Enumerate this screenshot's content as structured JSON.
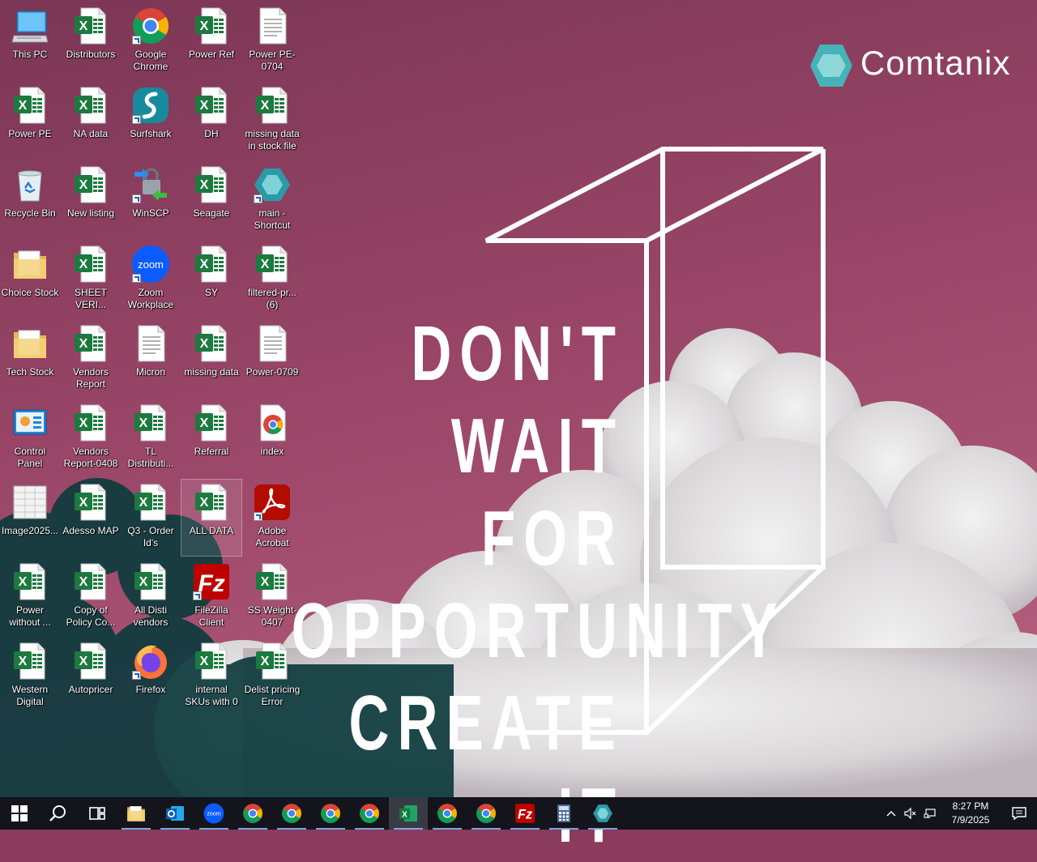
{
  "wallpaper": {
    "brand": "Comtanix",
    "quote_lines": [
      "DON'T",
      "WAIT FOR",
      "OPPORTUNITY",
      "CREATE IT"
    ],
    "colors": {
      "sky": "#8a3b5e",
      "accent": "#45b3b8"
    }
  },
  "desktop_icons": [
    {
      "label": "This PC",
      "icon": "this-pc-icon"
    },
    {
      "label": "Distributors",
      "icon": "excel-file-icon"
    },
    {
      "label": "Google Chrome",
      "icon": "chrome-icon"
    },
    {
      "label": "Power Ref",
      "icon": "excel-file-icon"
    },
    {
      "label": "Power PE-0704",
      "icon": "text-file-icon"
    },
    {
      "label": "Power PE",
      "icon": "excel-file-icon"
    },
    {
      "label": "NA data",
      "icon": "excel-file-icon"
    },
    {
      "label": "Surfshark",
      "icon": "surfshark-icon"
    },
    {
      "label": "DH",
      "icon": "excel-file-icon"
    },
    {
      "label": "missing data in stock file",
      "icon": "excel-file-icon"
    },
    {
      "label": "Recycle Bin",
      "icon": "recycle-bin-icon"
    },
    {
      "label": "New listing",
      "icon": "excel-file-icon"
    },
    {
      "label": "WinSCP",
      "icon": "winscp-icon"
    },
    {
      "label": "Seagate",
      "icon": "excel-file-icon"
    },
    {
      "label": "main - Shortcut",
      "icon": "comtanix-app-icon"
    },
    {
      "label": "Choice Stock",
      "icon": "folder-icon"
    },
    {
      "label": "SHEET VERI...",
      "icon": "excel-file-icon"
    },
    {
      "label": "Zoom Workplace",
      "icon": "zoom-icon"
    },
    {
      "label": "SY",
      "icon": "excel-file-icon"
    },
    {
      "label": "filtered-pr... (6)",
      "icon": "excel-file-icon"
    },
    {
      "label": "Tech Stock",
      "icon": "folder-icon"
    },
    {
      "label": "Vendors Report",
      "icon": "excel-file-icon"
    },
    {
      "label": "Micron",
      "icon": "text-file-icon"
    },
    {
      "label": "missing data",
      "icon": "excel-file-icon"
    },
    {
      "label": "Power-0709",
      "icon": "text-file-icon"
    },
    {
      "label": "Control Panel",
      "icon": "control-panel-icon"
    },
    {
      "label": "Vendors Report-0408",
      "icon": "excel-file-icon"
    },
    {
      "label": "TL Distributi...",
      "icon": "excel-file-icon"
    },
    {
      "label": "Referral",
      "icon": "excel-file-icon"
    },
    {
      "label": "index",
      "icon": "chrome-html-icon"
    },
    {
      "label": "Image2025...",
      "icon": "image-file-icon"
    },
    {
      "label": "Adesso MAP",
      "icon": "excel-file-icon"
    },
    {
      "label": "Q3 - Order Id's",
      "icon": "excel-file-icon"
    },
    {
      "label": "ALL DATA",
      "icon": "excel-file-icon"
    },
    {
      "label": "Adobe Acrobat",
      "icon": "acrobat-icon"
    },
    {
      "label": "Power without ...",
      "icon": "excel-file-icon"
    },
    {
      "label": "Copy of Policy Co...",
      "icon": "excel-file-icon"
    },
    {
      "label": "All Disti vendors",
      "icon": "excel-file-icon"
    },
    {
      "label": "FileZilla Client",
      "icon": "filezilla-icon"
    },
    {
      "label": "SS Weight-0407",
      "icon": "excel-file-icon"
    },
    {
      "label": "Western Digital",
      "icon": "excel-file-icon"
    },
    {
      "label": "Autopricer",
      "icon": "excel-file-icon"
    },
    {
      "label": "Firefox",
      "icon": "firefox-icon"
    },
    {
      "label": "internal SKUs with 0",
      "icon": "excel-file-icon"
    },
    {
      "label": "Delist pricing Error",
      "icon": "excel-file-icon"
    }
  ],
  "taskbar": {
    "buttons": [
      {
        "name": "start-button",
        "icon": "windows-logo-icon"
      },
      {
        "name": "search-button",
        "icon": "search-icon"
      },
      {
        "name": "task-view-button",
        "icon": "task-view-icon"
      },
      {
        "name": "taskbar-file-explorer",
        "icon": "folder-icon"
      },
      {
        "name": "taskbar-outlook",
        "icon": "outlook-icon"
      },
      {
        "name": "taskbar-zoom",
        "icon": "zoom-icon"
      },
      {
        "name": "taskbar-chrome-w",
        "icon": "chrome-icon"
      },
      {
        "name": "taskbar-chrome-2",
        "icon": "chrome-icon"
      },
      {
        "name": "taskbar-chrome-3",
        "icon": "chrome-icon"
      },
      {
        "name": "taskbar-chrome-4",
        "icon": "chrome-icon"
      },
      {
        "name": "taskbar-excel",
        "icon": "excel-icon"
      },
      {
        "name": "taskbar-chrome-5",
        "icon": "chrome-icon"
      },
      {
        "name": "taskbar-chrome-6",
        "icon": "chrome-icon"
      },
      {
        "name": "taskbar-filezilla",
        "icon": "filezilla-icon"
      },
      {
        "name": "taskbar-calculator",
        "icon": "calculator-icon"
      },
      {
        "name": "taskbar-comtanix",
        "icon": "comtanix-app-icon"
      }
    ],
    "clock": {
      "time": "8:27 PM",
      "date": "7/9/2025"
    }
  }
}
